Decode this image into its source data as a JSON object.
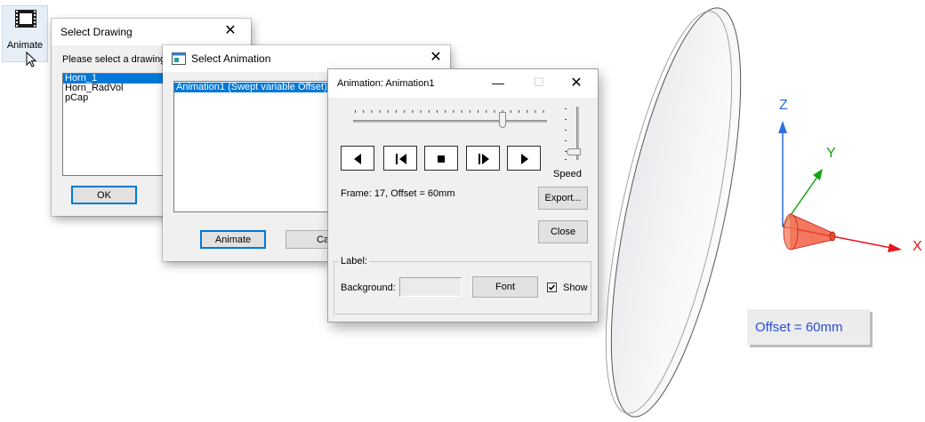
{
  "toolbar": {
    "animate_label": "Animate"
  },
  "select_drawing": {
    "title": "Select Drawing",
    "prompt": "Please select a drawing",
    "items": [
      "Horn_1",
      "Horn_RadVol",
      "pCap"
    ],
    "ok_label": "OK"
  },
  "select_animation": {
    "title": "Select Animation",
    "items": [
      "Animation1 (Swept variable Offset)"
    ],
    "animate_label": "Animate",
    "cancel_label_partial": "Ca"
  },
  "animation_window": {
    "title": "Animation: Animation1",
    "frame_status": "Frame: 17, Offset = 60mm",
    "speed_label": "Speed",
    "export_label": "Export...",
    "close_label": "Close",
    "label_group": "Label:",
    "background_label": "Background:",
    "font_label": "Font",
    "show_label": "Show",
    "show_checked": true,
    "frame_position_fraction": 0.78,
    "speed_fraction": 0.9
  },
  "viewport": {
    "offset_label": "Offset = 60mm",
    "axes": {
      "x": "X",
      "y": "Y",
      "z": "Z"
    },
    "colors": {
      "x_axis": "#e8141c",
      "y_axis": "#16a316",
      "z_axis": "#2f6fe0",
      "offset_text": "#2a4fd8",
      "cone": "#f04a2a"
    }
  }
}
